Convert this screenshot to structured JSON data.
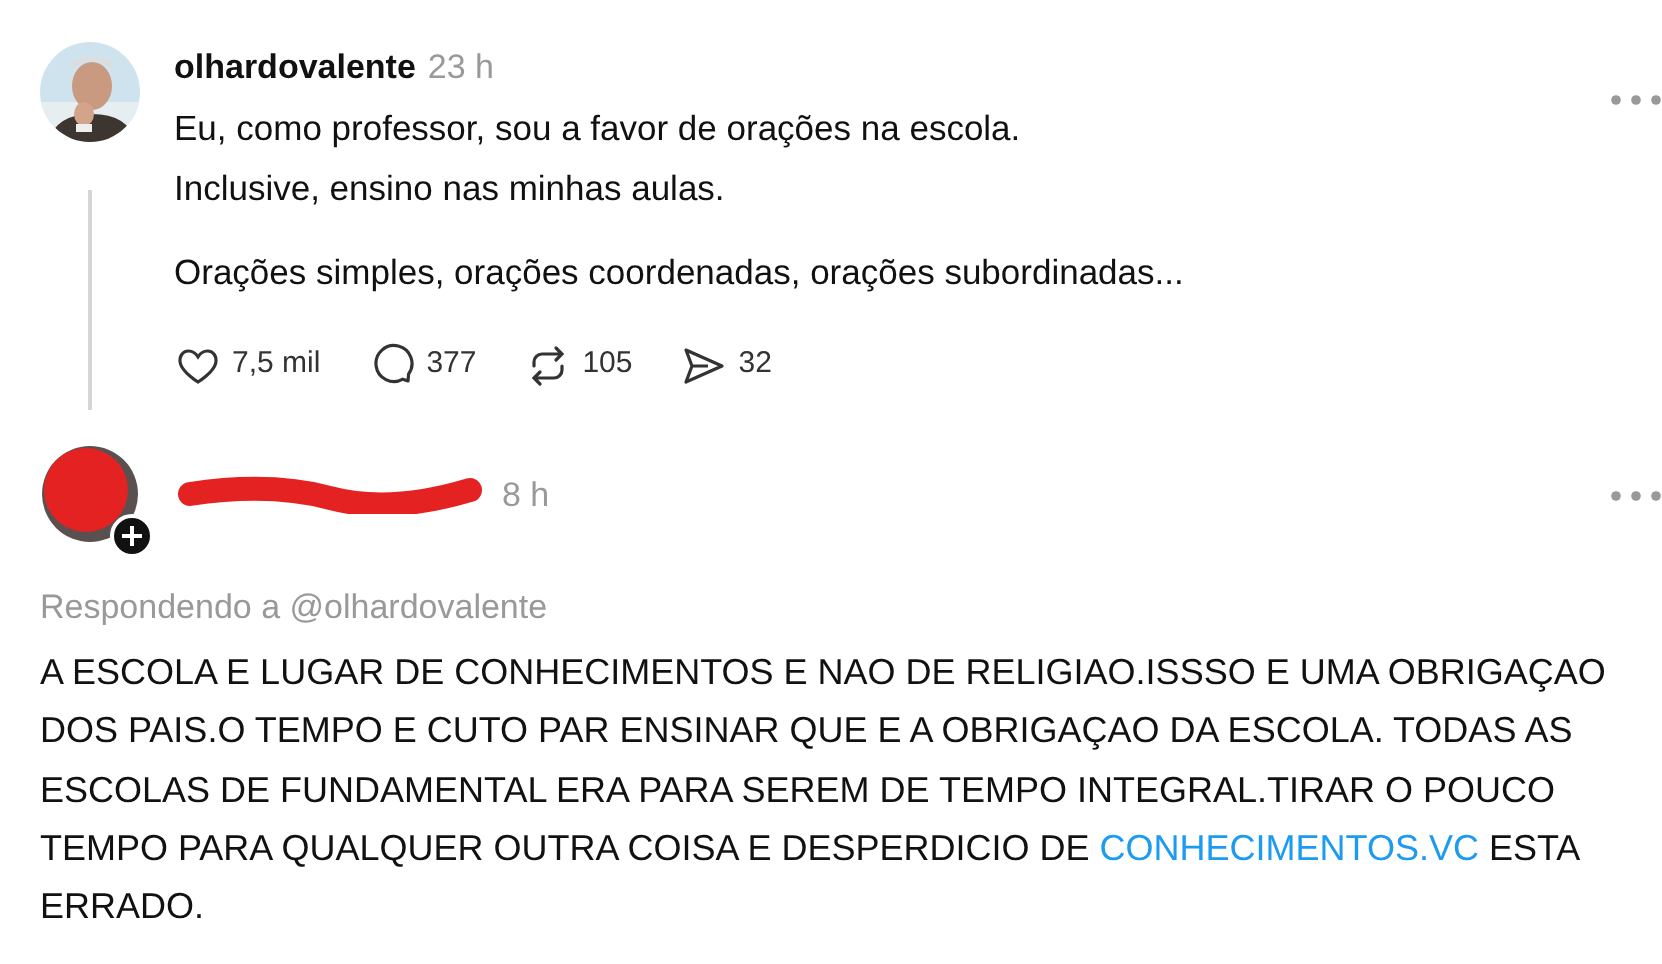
{
  "posts": [
    {
      "kind": "original",
      "username": "olhardovalente",
      "time": "23 h",
      "paragraphs": [
        "Eu, como professor, sou a favor de orações na escola.\nInclusive, ensino nas minhas aulas.",
        "Orações simples, orações coordenadas, orações subordinadas..."
      ],
      "actions": [
        {
          "kind": "like",
          "count": "7,5 mil"
        },
        {
          "kind": "comment",
          "count": "377"
        },
        {
          "kind": "repost",
          "count": "105"
        },
        {
          "kind": "share",
          "count": "32"
        }
      ]
    },
    {
      "kind": "reply",
      "username_redacted": true,
      "time": "8 h",
      "replying_to": "Respondendo a @olhardovalente",
      "body": "A ESCOLA E LUGAR DE CONHECIMENTOS E NAO DE RELIGIAO.ISSSO E UMA OBRIGAÇAO DOS PAIS.O TEMPO E CUTO PAR ENSINAR QUE E A OBRIGAÇAO DA ESCOLA. TODAS AS ESCOLAS DE FUNDAMENTAL ERA PARA SEREM DE TEMPO INTEGRAL.TIRAR O POUCO TEMPO PARA QUALQUER OUTRA COISA E DESPERDICIO DE ",
      "link": "CONHECIMENTOS.VC",
      "body_end": " ESTA ERRADO."
    }
  ]
}
